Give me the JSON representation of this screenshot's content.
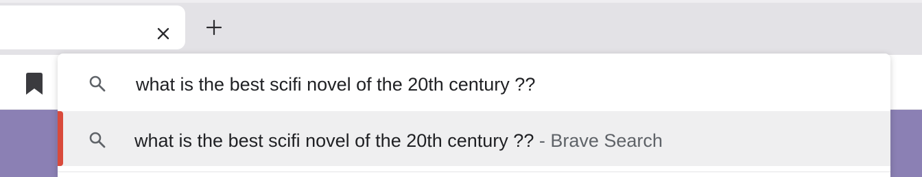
{
  "tabstrip": {
    "tab": {
      "close_icon": "close-icon"
    },
    "new_tab_icon": "plus-icon"
  },
  "toolbar": {
    "bookmark_icon": "bookmark-icon"
  },
  "omnibox": {
    "query": "what is the best scifi novel of the 20th century ??",
    "query_icon": "search-icon",
    "suggestions": [
      {
        "text": "what is the best scifi novel of the 20th century ??",
        "suffix": " - Brave Search",
        "icon": "search-icon"
      }
    ]
  },
  "colors": {
    "tabstrip_bg": "#e3e2e6",
    "selection_accent": "#d94a3b",
    "page_bg": "#8b80b4",
    "selected_row_bg": "#efeff0"
  }
}
